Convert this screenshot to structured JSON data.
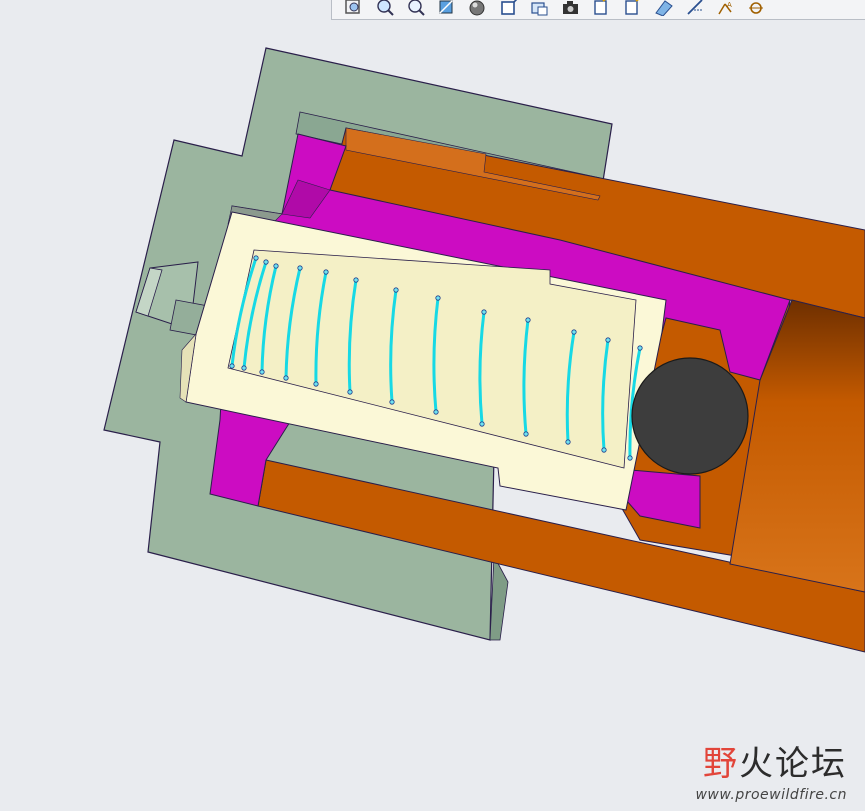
{
  "toolbar": {
    "buttons": [
      {
        "name": "zoom-fit-icon",
        "label": ""
      },
      {
        "name": "zoom-in-icon",
        "label": ""
      },
      {
        "name": "zoom-out-icon",
        "label": ""
      },
      {
        "name": "repaint-icon",
        "label": ""
      },
      {
        "name": "shading-icon",
        "label": ""
      },
      {
        "name": "view-orient-icon",
        "label": ""
      },
      {
        "name": "saved-views-icon",
        "label": ""
      },
      {
        "name": "camera-icon",
        "label": ""
      },
      {
        "name": "datum-planes-icon",
        "label": ""
      },
      {
        "name": "datum-axes-icon",
        "label": ""
      },
      {
        "name": "datum-points-icon",
        "label": ""
      },
      {
        "name": "coord-sys-icon",
        "label": ""
      },
      {
        "name": "annotations-icon",
        "label": ""
      },
      {
        "name": "spin-center-icon",
        "label": ""
      }
    ]
  },
  "model": {
    "colors": {
      "background": "#e9ebef",
      "housing": "#9bb59f",
      "bushing": "#cc0cc2",
      "plunger": "#c45a00",
      "spring_holder": "#fbf8d7",
      "spring": "#17d9e5",
      "ball": "#3d3d3d"
    }
  },
  "watermark": {
    "brand_red": "野",
    "brand_rest": "火论坛",
    "url": "www.proewildfire.cn"
  }
}
